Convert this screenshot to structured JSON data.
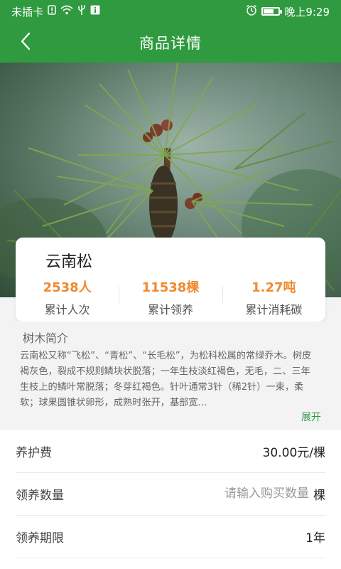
{
  "statusbar": {
    "carrier": "未插卡",
    "time": "晚上9:29"
  },
  "header": {
    "title": "商品详情"
  },
  "tree": {
    "name": "云南松",
    "stats": [
      {
        "value": "2538人",
        "label": "累计人次"
      },
      {
        "value": "11538棵",
        "label": "累计领养"
      },
      {
        "value": "1.27吨",
        "label": "累计消耗碳"
      }
    ]
  },
  "intro": {
    "title": "树木简介",
    "text": "云南松又称“飞松”、“青松”、“长毛松”，为松科松属的常绿乔木。树皮褐灰色，裂成不规则鳞块状脱落；一年生枝淡红褐色，无毛，二、三年生枝上的鳞叶常脱落；冬芽红褐色。针叶通常3针（稀2针）一束，柔软；球果圆锥状卵形，成熟时张开，基部宽...",
    "expand_label": "展开"
  },
  "form": {
    "fee_label": "养护费",
    "fee_value": "30.00元/棵",
    "qty_label": "领养数量",
    "qty_placeholder": "请输入购买数量",
    "qty_unit": "棵",
    "term_label": "领养期限",
    "term_value": "1年"
  },
  "icons": {
    "back": "chevron-left-icon",
    "alarm": "alarm-icon",
    "battery": "battery-icon",
    "wifi": "wifi-icon",
    "usb": "usb-icon"
  },
  "colors": {
    "primary": "#2f9a3f",
    "accent": "#f08a2e"
  }
}
